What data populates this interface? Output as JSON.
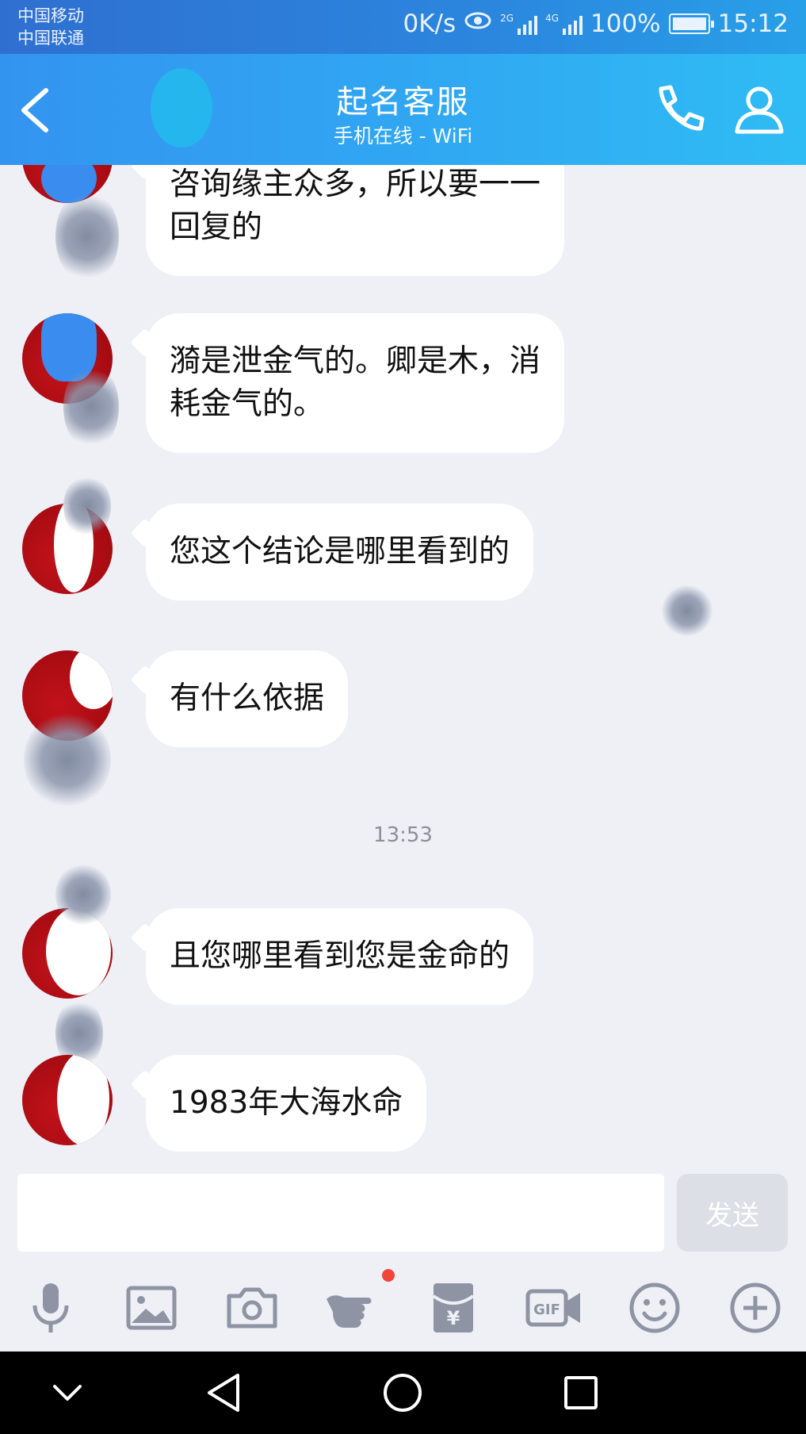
{
  "status_bar": {
    "carrier_1": "中国移动",
    "carrier_2": "中国联通",
    "speed": "0K/s",
    "signal_1_label": "2G",
    "signal_2_label": "4G",
    "battery": "100%",
    "time": "15:12"
  },
  "header": {
    "title": "起名客服",
    "subtitle": "手机在线 - WiFi",
    "back_icon": "chevron-left-icon",
    "call_icon": "phone-icon",
    "profile_icon": "user-icon"
  },
  "messages": [
    {
      "text": "咨询缘主众多，所以要一一\n回复的"
    },
    {
      "text": "漪是泄金气的。卿是木，消\n耗金气的。"
    },
    {
      "text": "您这个结论是哪里看到的"
    },
    {
      "text": "有什么依据"
    },
    {
      "text": "且您哪里看到您是金命的"
    },
    {
      "text": "1983年大海水命"
    }
  ],
  "timestamp": "13:53",
  "composer": {
    "input_value": "",
    "send_label": "发送"
  },
  "toolbar": [
    "microphone-icon",
    "image-icon",
    "camera-icon",
    "poke-hand-icon",
    "red-packet-icon",
    "gif-icon",
    "emoji-icon",
    "plus-icon"
  ],
  "navbar": [
    "nav-down-icon",
    "nav-back-icon",
    "nav-home-icon",
    "nav-recents-icon"
  ],
  "colors": {
    "header_start": "#3394f0",
    "header_end": "#2fbcf4",
    "chat_bg": "#eef0f6",
    "avatar_red": "#a60b12",
    "notification_dot": "#f3443a"
  }
}
